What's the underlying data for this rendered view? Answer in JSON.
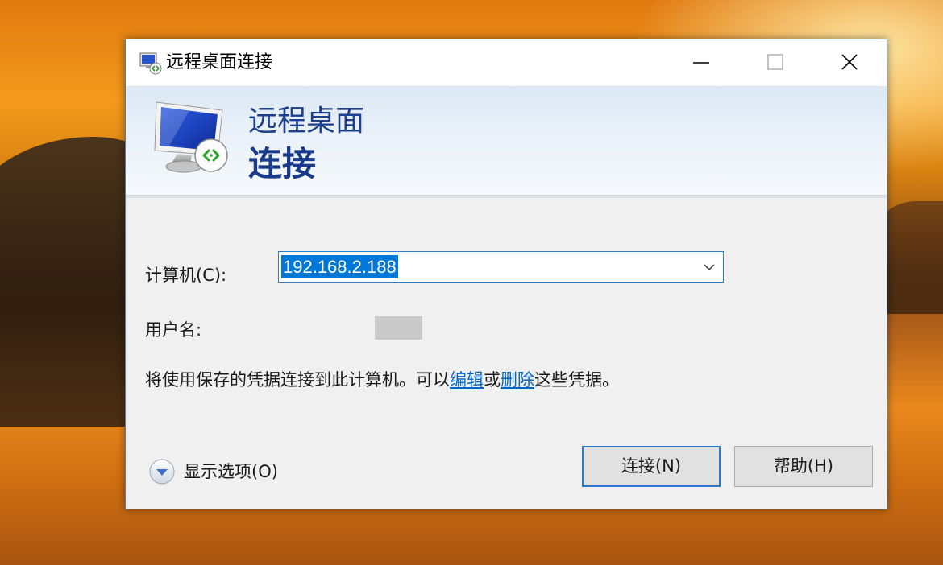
{
  "window": {
    "title": "远程桌面连接",
    "icon": "remote-desktop-icon",
    "controls": [
      "minimize-icon",
      "maximize-icon",
      "close-icon"
    ]
  },
  "banner": {
    "line1": "远程桌面",
    "line2": "连接",
    "icon": "monitor-remote-icon"
  },
  "form": {
    "computer_label": "计算机(C):",
    "computer_value": "192.168.2.188",
    "user_label": "用户名:",
    "user_value": ""
  },
  "info": {
    "prefix": "将使用保存的凭据连接到此计算机。可以",
    "edit_link": "编辑",
    "middle": "或",
    "delete_link": "删除",
    "suffix": "这些凭据。"
  },
  "footer": {
    "options_label": "显示选项(O)",
    "connect_button": "连接(N)",
    "help_button": "帮助(H)"
  },
  "colors": {
    "accent": "#0078d7",
    "banner_text": "#1d3f8c",
    "link": "#0066cc"
  }
}
